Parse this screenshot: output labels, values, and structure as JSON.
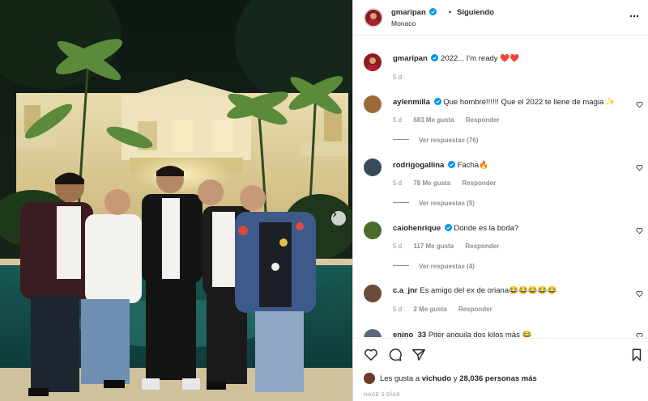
{
  "post": {
    "photo_description": "",
    "author": "gmaripan",
    "follow_label": "Siguiendo",
    "location": "Monaco",
    "caption": "2022... I'm ready ❤️❤️",
    "caption_age": "5 d"
  },
  "comments": [
    {
      "user": "aylenmilla",
      "verified": true,
      "text": "Que hombre!!!!!! Que el 2022 te llene de magia ✨",
      "age": "5 d",
      "likes": "683 Me gusta",
      "reply": "Responder",
      "replies": "Ver respuestas (76)",
      "avatar_color": "#9a6a3a"
    },
    {
      "user": "rodrigogallina",
      "verified": true,
      "text": "Facha🔥",
      "age": "5 d",
      "likes": "78 Me gusta",
      "reply": "Responder",
      "replies": "Ver respuestas (5)",
      "avatar_color": "#3a4a5a"
    },
    {
      "user": "caiohenrique",
      "verified": true,
      "text": "Donde es la boda?",
      "age": "5 d",
      "likes": "117 Me gusta",
      "reply": "Responder",
      "replies": "Ver respuestas (4)",
      "avatar_color": "#4a6a2a"
    },
    {
      "user": "c.a_jnr",
      "verified": false,
      "text": "Es amigo del ex de oriana😂😂😂😂😂",
      "age": "5 d",
      "likes": "2 Me gusta",
      "reply": "Responder",
      "replies": "",
      "avatar_color": "#6a4a3a"
    },
    {
      "user": "enino_33",
      "verified": false,
      "text": "Piter anguila dos kilos más 😂",
      "age": "",
      "likes": "",
      "reply": "",
      "replies": "",
      "avatar_color": "#5a6a7a"
    }
  ],
  "footer": {
    "likes_prefix": "Les gusta a ",
    "likes_user": "vichudo",
    "likes_middle": " y ",
    "likes_count": "28,036 personas más",
    "time_ago": "HACE 5 DÍAS"
  },
  "icons": {
    "verified": "verified-badge-icon",
    "more": "more-options-icon",
    "heart": "heart-icon",
    "comment": "comment-icon",
    "share": "share-icon",
    "save": "bookmark-icon",
    "next": "chevron-right-icon"
  },
  "colors": {
    "accent": "#0095f6",
    "secondary_text": "#8e8e8e",
    "primary_text": "#262626"
  }
}
